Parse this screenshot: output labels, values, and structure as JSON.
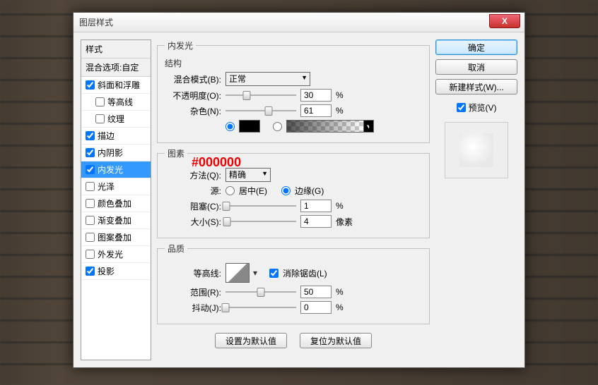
{
  "dialog": {
    "title": "图层样式"
  },
  "buttons": {
    "ok": "确定",
    "cancel": "取消",
    "newStyle": "新建样式(W)...",
    "setDefault": "设置为默认值",
    "resetDefault": "复位为默认值"
  },
  "preview": {
    "label": "预览(V)"
  },
  "sidebar": {
    "header": "样式",
    "blendOptions": "混合选项:自定",
    "items": [
      {
        "label": "斜面和浮雕",
        "checked": true
      },
      {
        "label": "等高线",
        "checked": false,
        "indent": true
      },
      {
        "label": "纹理",
        "checked": false,
        "indent": true
      },
      {
        "label": "描边",
        "checked": true
      },
      {
        "label": "内阴影",
        "checked": true
      },
      {
        "label": "内发光",
        "checked": true,
        "selected": true
      },
      {
        "label": "光泽",
        "checked": false
      },
      {
        "label": "颜色叠加",
        "checked": false
      },
      {
        "label": "渐变叠加",
        "checked": false
      },
      {
        "label": "图案叠加",
        "checked": false
      },
      {
        "label": "外发光",
        "checked": false
      },
      {
        "label": "投影",
        "checked": true
      }
    ]
  },
  "panel": {
    "title": "内发光",
    "structure": {
      "legend": "结构",
      "blendMode": {
        "label": "混合模式(B):",
        "value": "正常"
      },
      "opacity": {
        "label": "不透明度(O):",
        "value": "30",
        "unit": "%",
        "pct": 30
      },
      "noise": {
        "label": "杂色(N):",
        "value": "61",
        "unit": "%",
        "pct": 61
      },
      "colorHex": "#000000"
    },
    "elements": {
      "legend": "图素",
      "technique": {
        "label": "方法(Q):",
        "value": "精确"
      },
      "sourceLabel": "源:",
      "sourceCenter": "居中(E)",
      "sourceEdge": "边缘(G)",
      "choke": {
        "label": "阻塞(C):",
        "value": "1",
        "unit": "%",
        "pct": 1
      },
      "size": {
        "label": "大小(S):",
        "value": "4",
        "unit": "像素",
        "pct": 2
      }
    },
    "quality": {
      "legend": "品质",
      "contour": "等高线:",
      "antiAlias": "消除锯齿(L)",
      "range": {
        "label": "范围(R):",
        "value": "50",
        "unit": "%",
        "pct": 50
      },
      "jitter": {
        "label": "抖动(J):",
        "value": "0",
        "unit": "%",
        "pct": 0
      }
    }
  }
}
